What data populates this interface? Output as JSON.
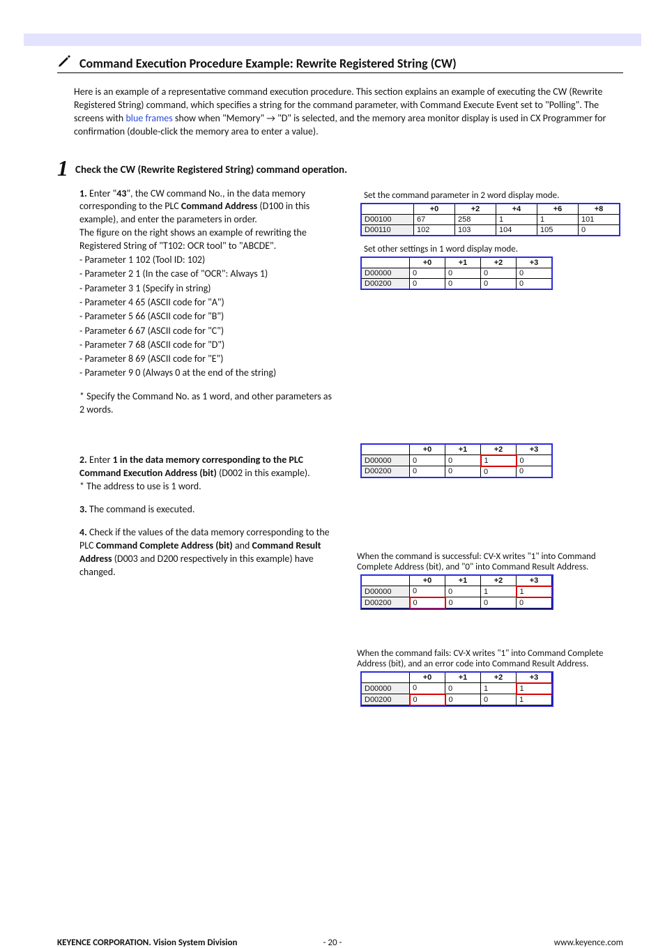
{
  "heading": "Command Execution Procedure Example: Rewrite Registered String (CW)",
  "intro_parts": {
    "p1": "Here is an example of a representative command execution procedure. This section explains an example of executing the CW (Rewrite Registered String) command, which specifies a string for the command parameter, with Command Execute Event set to \"Polling\".  The screens with ",
    "blue": "blue frames",
    "p2": " show when \"Memory\" → \"D\" is selected, and the memory area monitor display is used in CX Programmer  for confirmation (double-click the memory area to enter a value)."
  },
  "step_num": "1",
  "step_title": "Check the CW (Rewrite Registered String) command operation.",
  "left": {
    "sec1_a": "1.",
    "sec1_b": " Enter \"",
    "sec1_c": "43",
    "sec1_d": "\", the CW command No., in the data memory corresponding to the PLC ",
    "sec1_e": "Command Address",
    "sec1_f": " (D100 in this example), and enter the parameters in order.",
    "sec1_g": "The figure on the right shows an example of rewriting the Registered String of \"T102: OCR tool\" to \"ABCDE\".",
    "params": [
      "- Parameter 1  102  (Tool ID: 102)",
      "- Parameter 2  1  (In the case of \"OCR\": Always 1)",
      "- Parameter 3  1  (Specify in string)",
      "- Parameter 4  65  (ASCII code for \"A\")",
      "- Parameter 5  66  (ASCII code for \"B\")",
      "- Parameter 6  67  (ASCII code for \"C\")",
      "- Parameter 7  68  (ASCII code for \"D\")",
      "- Parameter 8  69  (ASCII code for \"E\")",
      "- Parameter 9  0  (Always 0 at the end of the string)"
    ],
    "sec1_note": "* Specify the Command No. as 1 word, and other parameters as 2 words.",
    "sec2_a": "2.",
    "sec2_b": " Enter ",
    "sec2_c": "1 in the data memory corresponding to the PLC Command Execution Address (bit)",
    "sec2_d": " (D002 in this example).",
    "sec2_e": " * The address to use is 1 word.",
    "sec3_a": "3.",
    "sec3_b": " The command is executed.",
    "sec4_a": "4.",
    "sec4_b": " Check if the values of the data memory corresponding to the PLC ",
    "sec4_c": "Command Complete Address (bit)",
    "sec4_d": " and ",
    "sec4_e": "Command Result Address",
    "sec4_f": " (D003 and D200 respectively in this example) have changed."
  },
  "right": {
    "cap1": "Set the command parameter in 2 word display mode.",
    "table1": {
      "headers": [
        "",
        "+0",
        "+2",
        "+4",
        "+6",
        "+8"
      ],
      "rows": [
        [
          "D00100",
          "67",
          "258",
          "1",
          "1",
          "101"
        ],
        [
          "D00110",
          "102",
          "103",
          "104",
          "105",
          "0"
        ]
      ]
    },
    "cap2": "Set other settings in 1 word display mode.",
    "table2": {
      "headers": [
        "",
        "+0",
        "+1",
        "+2",
        "+3"
      ],
      "rows": [
        [
          "D00000",
          "0",
          "0",
          "0",
          "0"
        ],
        [
          "D00200",
          "0",
          "0",
          "0",
          "0"
        ]
      ]
    },
    "table3": {
      "headers": [
        "",
        "+0",
        "+1",
        "+2",
        "+3"
      ],
      "rows": [
        [
          "D00000",
          "0",
          "0",
          "1",
          "0"
        ],
        [
          "D00200",
          "0",
          "0",
          "0",
          "0"
        ]
      ],
      "red": [
        [
          0,
          2
        ]
      ]
    },
    "cap4": "When the command is successful: CV-X writes \"1\" into Command Complete Address (bit), and \"0\" into Command Result Address.",
    "table4": {
      "headers": [
        "",
        "+0",
        "+1",
        "+2",
        "+3"
      ],
      "rows": [
        [
          "D00000",
          "0",
          "0",
          "1",
          "1"
        ],
        [
          "D00200",
          "0",
          "0",
          "0",
          "0"
        ]
      ],
      "red": [
        [
          0,
          3
        ],
        [
          1,
          0
        ]
      ]
    },
    "cap5": "When the command fails: CV-X writes \"1\" into Command Complete Address (bit), and an error code into Command Result Address.",
    "table5": {
      "headers": [
        "",
        "+0",
        "+1",
        "+2",
        "+3"
      ],
      "rows": [
        [
          "D00000",
          "0",
          "0",
          "1",
          "1"
        ],
        [
          "D00200",
          "0",
          "0",
          "0",
          "1"
        ]
      ],
      "red": [
        [
          0,
          3
        ],
        [
          1,
          0
        ]
      ]
    }
  },
  "footer": {
    "left": "KEYENCE CORPORATION. Vision System Division",
    "mid": "- 20 -",
    "right": "www.keyence.com"
  },
  "colwidths": {
    "wide": [
      66,
      50,
      50,
      50,
      50,
      50
    ],
    "narrow": [
      60,
      42,
      42,
      42,
      42
    ]
  }
}
